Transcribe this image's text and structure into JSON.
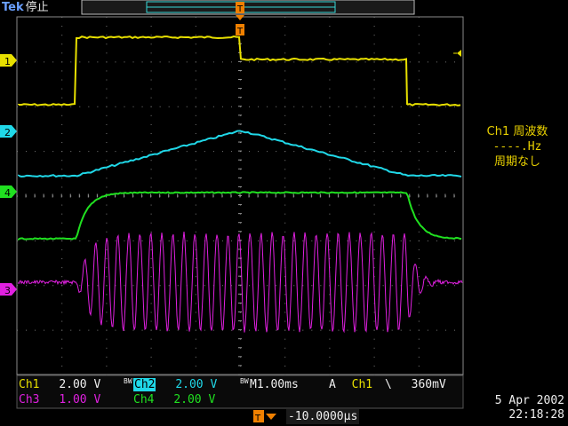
{
  "brand": {
    "name": "Tek",
    "state": "停止"
  },
  "channels": [
    {
      "id": "ch1",
      "marker": "1",
      "color": "#e8e000"
    },
    {
      "id": "ch2",
      "marker": "2",
      "color": "#20d8e8"
    },
    {
      "id": "ch3",
      "marker": "3",
      "color": "#e020e0"
    },
    {
      "id": "ch4",
      "marker": "4",
      "color": "#20e020"
    }
  ],
  "trigger_marker": "T",
  "readouts": {
    "ch1_label": "Ch1",
    "ch1_scale": "2.00 V",
    "ch2_label": "Ch2",
    "ch2_scale": "2.00 V",
    "ch3_label": "Ch3",
    "ch3_scale": "1.00 V",
    "ch4_label": "Ch4",
    "ch4_scale": "2.00 V",
    "bw1": "BW",
    "bw2": "BW",
    "timebase_label": "M",
    "timebase": "1.00ms",
    "trig_mode": "A",
    "trig_source": "Ch1",
    "trig_slope": "\\",
    "trig_level": "360mV",
    "trig_offset": "-10.0000μs"
  },
  "measurement": {
    "title": "Ch1 周波数",
    "value": "----.Hz",
    "status": "周期なし"
  },
  "datetime": {
    "date": "5 Apr 2002",
    "time": "22:18:28"
  }
}
